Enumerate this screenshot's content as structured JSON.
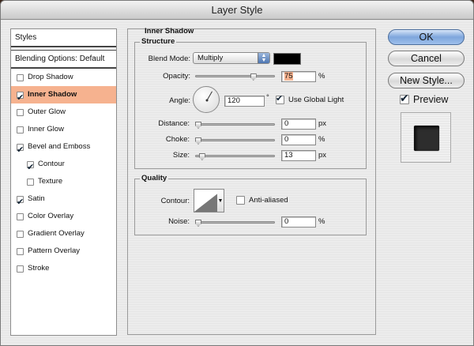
{
  "window": {
    "title": "Layer Style"
  },
  "styles_panel": {
    "header": "Styles",
    "blending_options": "Blending Options: Default",
    "items": [
      {
        "label": "Drop Shadow",
        "checked": false,
        "selected": false,
        "indent": false
      },
      {
        "label": "Inner Shadow",
        "checked": true,
        "selected": true,
        "indent": false
      },
      {
        "label": "Outer Glow",
        "checked": false,
        "selected": false,
        "indent": false
      },
      {
        "label": "Inner Glow",
        "checked": false,
        "selected": false,
        "indent": false
      },
      {
        "label": "Bevel and Emboss",
        "checked": true,
        "selected": false,
        "indent": false
      },
      {
        "label": "Contour",
        "checked": true,
        "selected": false,
        "indent": true
      },
      {
        "label": "Texture",
        "checked": false,
        "selected": false,
        "indent": true
      },
      {
        "label": "Satin",
        "checked": true,
        "selected": false,
        "indent": false
      },
      {
        "label": "Color Overlay",
        "checked": false,
        "selected": false,
        "indent": false
      },
      {
        "label": "Gradient Overlay",
        "checked": false,
        "selected": false,
        "indent": false
      },
      {
        "label": "Pattern Overlay",
        "checked": false,
        "selected": false,
        "indent": false
      },
      {
        "label": "Stroke",
        "checked": false,
        "selected": false,
        "indent": false
      }
    ]
  },
  "inner_shadow": {
    "title": "Inner Shadow",
    "structure": {
      "title": "Structure",
      "blend_mode_label": "Blend Mode:",
      "blend_mode_value": "Multiply",
      "shadow_color": "#000000",
      "opacity_label": "Opacity:",
      "opacity_value": "75",
      "opacity_unit": "%",
      "opacity_fraction": 0.75,
      "angle_label": "Angle:",
      "angle_value": "120",
      "angle_unit": "°",
      "use_global_light_label": "Use Global Light",
      "use_global_light": true,
      "distance_label": "Distance:",
      "distance_value": "0",
      "distance_unit": "px",
      "distance_fraction": 0,
      "choke_label": "Choke:",
      "choke_value": "0",
      "choke_unit": "%",
      "choke_fraction": 0,
      "size_label": "Size:",
      "size_value": "13",
      "size_unit": "px",
      "size_fraction": 0.052
    },
    "quality": {
      "title": "Quality",
      "contour_label": "Contour:",
      "anti_aliased_label": "Anti-aliased",
      "anti_aliased": false,
      "noise_label": "Noise:",
      "noise_value": "0",
      "noise_unit": "%",
      "noise_fraction": 0
    }
  },
  "buttons": {
    "ok": "OK",
    "cancel": "Cancel",
    "new_style": "New Style...",
    "preview_label": "Preview",
    "preview_checked": true
  },
  "colors": {
    "selection_highlight": "#f6b28f",
    "default_button": "#7ea6dc"
  }
}
